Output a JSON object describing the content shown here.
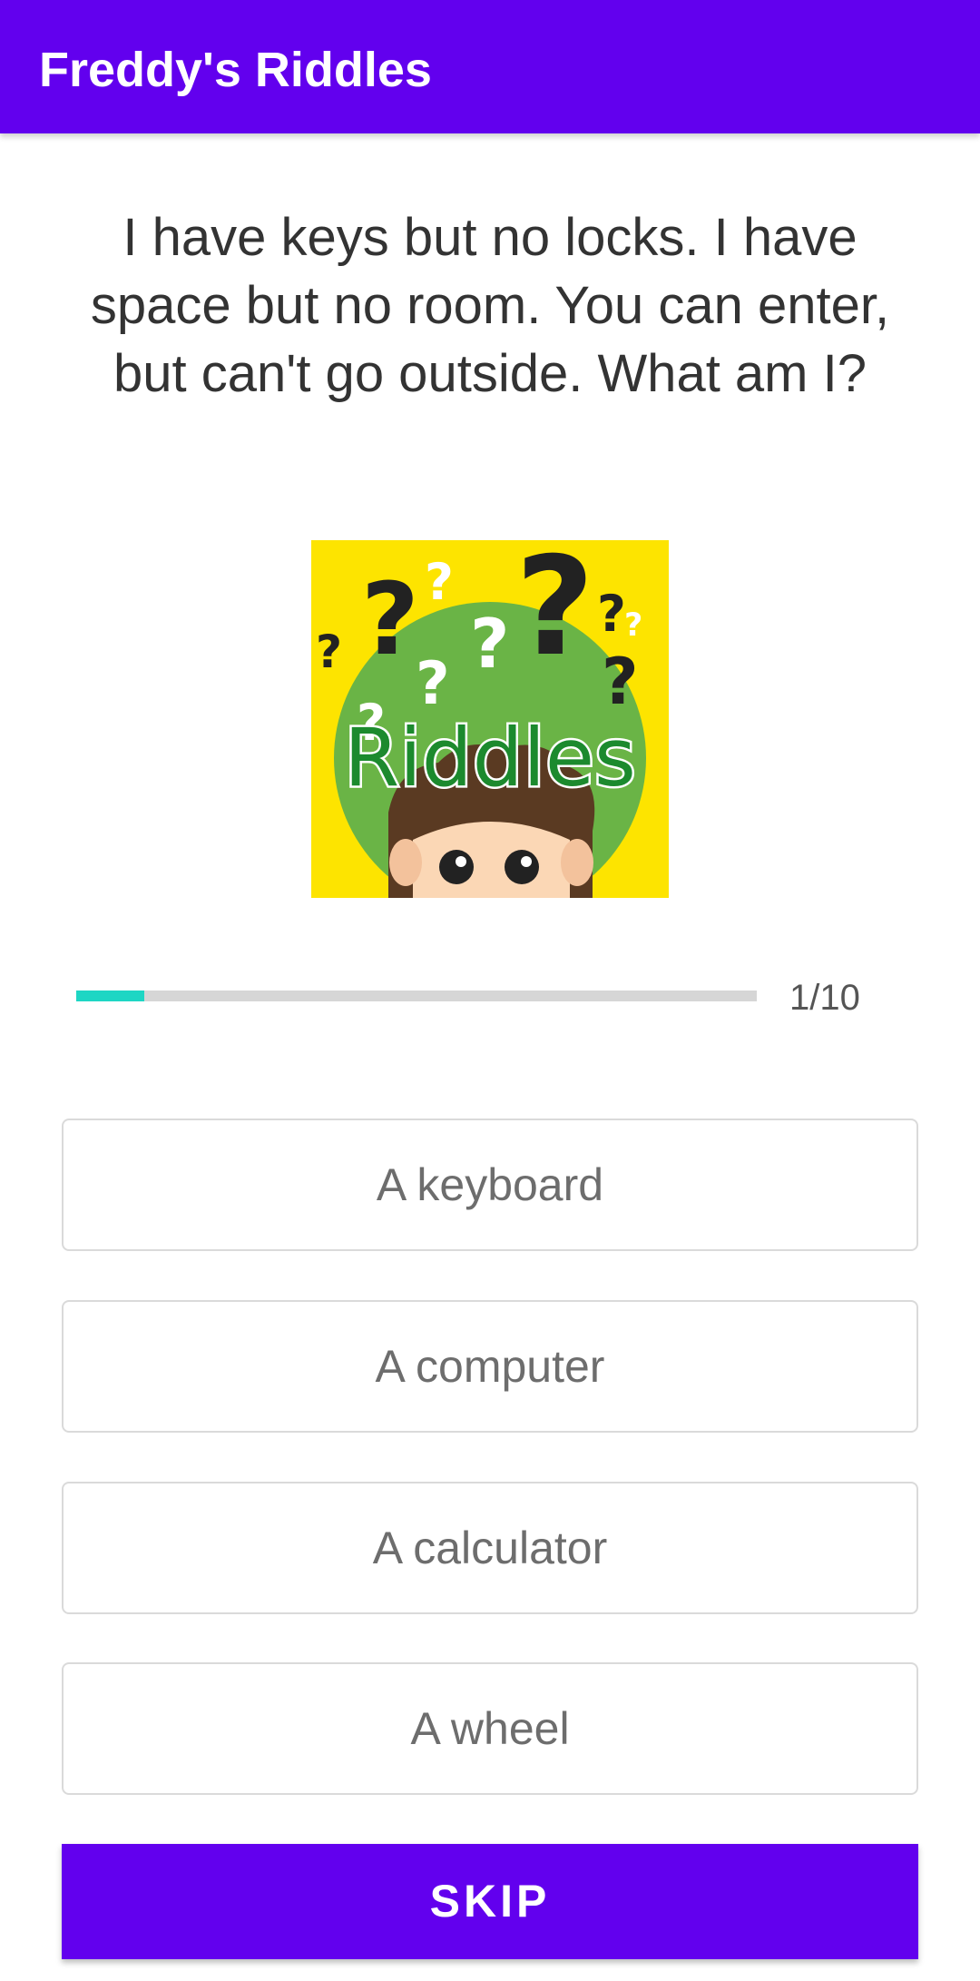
{
  "app_bar": {
    "title": "Freddy's Riddles",
    "color": "#6200EE"
  },
  "question": {
    "text": "I have keys but no locks. I have space but no room. You can enter, but can't go outside. What am I?"
  },
  "image": {
    "label": "Riddles",
    "background_color": "#fde400",
    "circle_color": "#6ab446"
  },
  "progress": {
    "current": 1,
    "total": 10,
    "label": "1/10",
    "fill_color": "#1ed6c4"
  },
  "options": [
    {
      "label": "A keyboard"
    },
    {
      "label": "A computer"
    },
    {
      "label": "A calculator"
    },
    {
      "label": "A wheel"
    }
  ],
  "skip": {
    "label": "SKIP"
  }
}
